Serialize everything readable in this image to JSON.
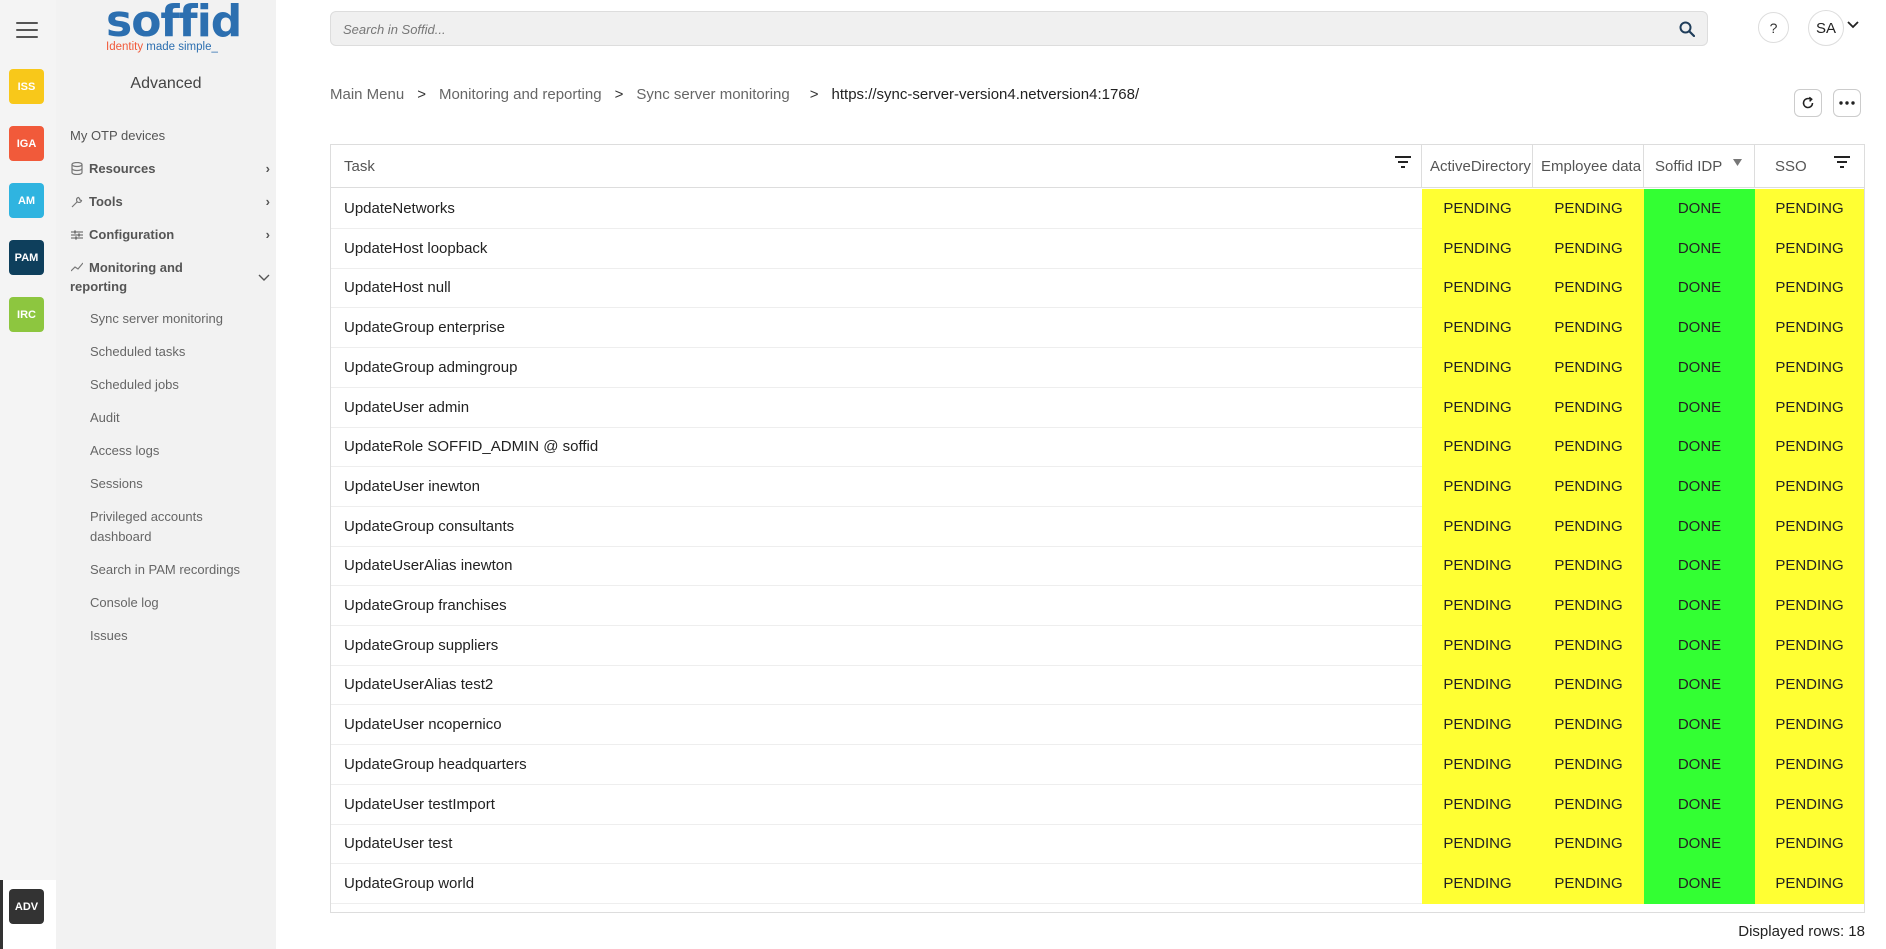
{
  "rail": {
    "apps": [
      {
        "label": "ISS",
        "color": "#f8c81a"
      },
      {
        "label": "IGA",
        "color": "#f15a3a"
      },
      {
        "label": "AM",
        "color": "#2fb4e0"
      },
      {
        "label": "PAM",
        "color": "#0e3f5c"
      },
      {
        "label": "IRC",
        "color": "#8dc63f"
      }
    ],
    "active_app": {
      "label": "ADV",
      "color": "#333333"
    }
  },
  "logo": {
    "word": "soffid",
    "tagline_a": "Identity",
    "tagline_b": " made simple_"
  },
  "sidebar": {
    "title": "Advanced",
    "items": [
      {
        "label": "My OTP devices"
      },
      {
        "label": "Resources"
      },
      {
        "label": "Tools"
      },
      {
        "label": "Configuration"
      },
      {
        "label": "Monitoring and reporting"
      }
    ],
    "subitems": [
      "Sync server monitoring",
      "Scheduled tasks",
      "Scheduled jobs",
      "Audit",
      "Access logs",
      "Sessions",
      "Privileged accounts dashboard",
      "Search in PAM recordings",
      "Console log",
      "Issues"
    ]
  },
  "topbar": {
    "search_placeholder": "Search in Soffid...",
    "help_label": "?",
    "user_initials": "SA"
  },
  "breadcrumb": {
    "items": [
      "Main Menu",
      "Monitoring and reporting",
      "Sync server monitoring"
    ],
    "current": "https://sync-server-version4.netversion4:1768/",
    "separator": ">"
  },
  "grid": {
    "columns": [
      "Task",
      "ActiveDirectory",
      "Employee data",
      "Soffid IDP",
      "SSO"
    ],
    "rows": [
      {
        "task": "UpdateNetworks",
        "status": [
          "PENDING",
          "PENDING",
          "DONE",
          "PENDING"
        ]
      },
      {
        "task": "UpdateHost loopback",
        "status": [
          "PENDING",
          "PENDING",
          "DONE",
          "PENDING"
        ]
      },
      {
        "task": "UpdateHost null",
        "status": [
          "PENDING",
          "PENDING",
          "DONE",
          "PENDING"
        ]
      },
      {
        "task": "UpdateGroup enterprise",
        "status": [
          "PENDING",
          "PENDING",
          "DONE",
          "PENDING"
        ]
      },
      {
        "task": "UpdateGroup admingroup",
        "status": [
          "PENDING",
          "PENDING",
          "DONE",
          "PENDING"
        ]
      },
      {
        "task": "UpdateUser admin",
        "status": [
          "PENDING",
          "PENDING",
          "DONE",
          "PENDING"
        ]
      },
      {
        "task": "UpdateRole SOFFID_ADMIN @ soffid",
        "status": [
          "PENDING",
          "PENDING",
          "DONE",
          "PENDING"
        ]
      },
      {
        "task": "UpdateUser inewton",
        "status": [
          "PENDING",
          "PENDING",
          "DONE",
          "PENDING"
        ]
      },
      {
        "task": "UpdateGroup consultants",
        "status": [
          "PENDING",
          "PENDING",
          "DONE",
          "PENDING"
        ]
      },
      {
        "task": "UpdateUserAlias inewton",
        "status": [
          "PENDING",
          "PENDING",
          "DONE",
          "PENDING"
        ]
      },
      {
        "task": "UpdateGroup franchises",
        "status": [
          "PENDING",
          "PENDING",
          "DONE",
          "PENDING"
        ]
      },
      {
        "task": "UpdateGroup suppliers",
        "status": [
          "PENDING",
          "PENDING",
          "DONE",
          "PENDING"
        ]
      },
      {
        "task": "UpdateUserAlias test2",
        "status": [
          "PENDING",
          "PENDING",
          "DONE",
          "PENDING"
        ]
      },
      {
        "task": "UpdateUser ncopernico",
        "status": [
          "PENDING",
          "PENDING",
          "DONE",
          "PENDING"
        ]
      },
      {
        "task": "UpdateGroup headquarters",
        "status": [
          "PENDING",
          "PENDING",
          "DONE",
          "PENDING"
        ]
      },
      {
        "task": "UpdateUser testImport",
        "status": [
          "PENDING",
          "PENDING",
          "DONE",
          "PENDING"
        ]
      },
      {
        "task": "UpdateUser test",
        "status": [
          "PENDING",
          "PENDING",
          "DONE",
          "PENDING"
        ]
      },
      {
        "task": "UpdateGroup world",
        "status": [
          "PENDING",
          "PENDING",
          "DONE",
          "PENDING"
        ]
      }
    ],
    "status_colors": {
      "PENDING": "#ffff33",
      "DONE": "#33ff33"
    },
    "footer": "Displayed rows: 18"
  }
}
